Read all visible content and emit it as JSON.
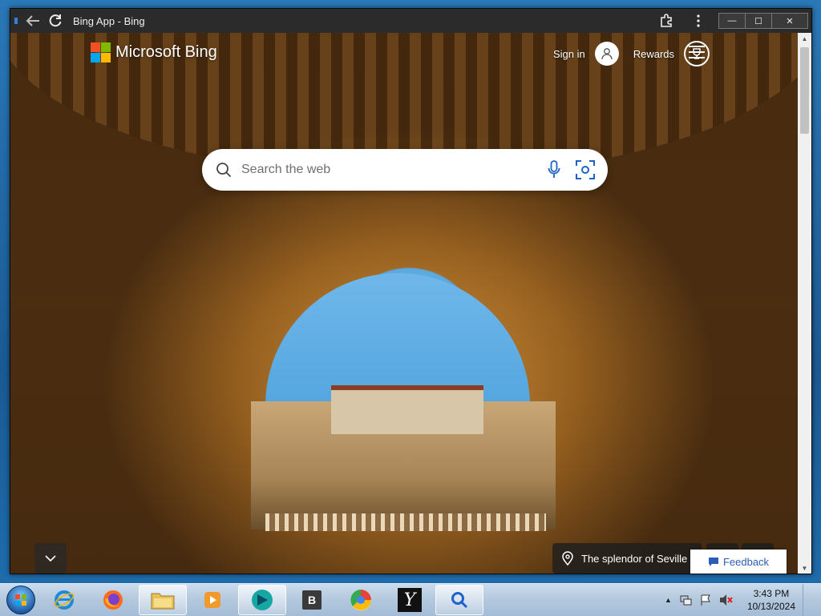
{
  "window": {
    "title": "Bing App - Bing",
    "minimize_label": "—",
    "maximize_label": "☐",
    "close_label": "✕"
  },
  "bing": {
    "brand": "Microsoft Bing",
    "sign_in": "Sign in",
    "rewards": "Rewards",
    "search_placeholder": "Search the web",
    "caption": "The splendor of Seville",
    "feedback": "Feedback"
  },
  "taskbar": {
    "items": [
      "start-button",
      "internet-explorer",
      "firefox",
      "file-explorer",
      "media-player",
      "bing-app",
      "b-app",
      "google-chrome",
      "y-app",
      "search"
    ],
    "time": "3:43 PM",
    "date": "10/13/2024"
  }
}
